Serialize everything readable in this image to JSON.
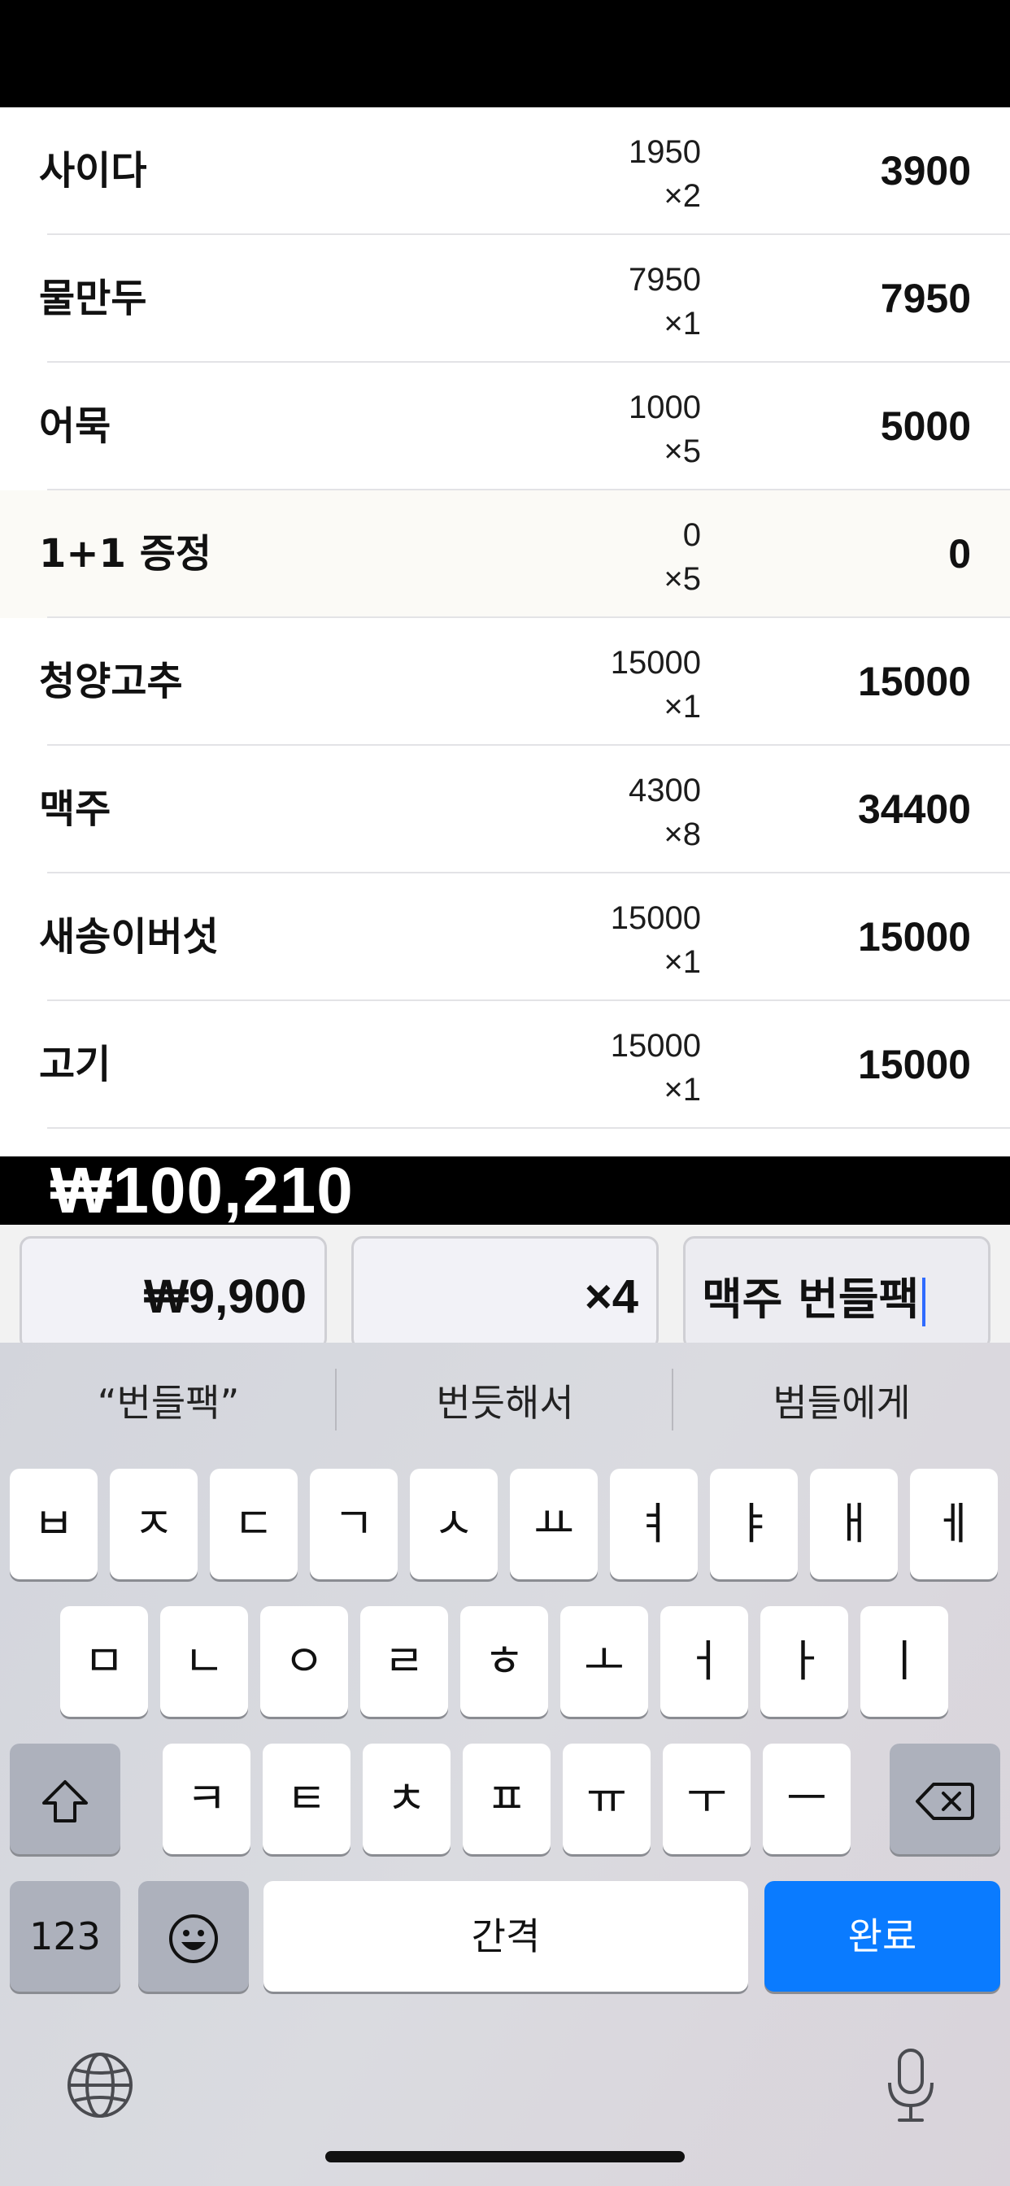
{
  "items": [
    {
      "name": "사이다",
      "unit_price": "1950",
      "qty": "×2",
      "total": "3900"
    },
    {
      "name": "물만두",
      "unit_price": "7950",
      "qty": "×1",
      "total": "7950"
    },
    {
      "name": "어묵",
      "unit_price": "1000",
      "qty": "×5",
      "total": "5000"
    },
    {
      "name": "1+1 증정",
      "unit_price": "0",
      "qty": "×5",
      "total": "0"
    },
    {
      "name": "청양고추",
      "unit_price": "15000",
      "qty": "×1",
      "total": "15000"
    },
    {
      "name": "맥주",
      "unit_price": "4300",
      "qty": "×8",
      "total": "34400"
    },
    {
      "name": "새송이버섯",
      "unit_price": "15000",
      "qty": "×1",
      "total": "15000"
    },
    {
      "name": "고기",
      "unit_price": "15000",
      "qty": "×1",
      "total": "15000"
    }
  ],
  "grand_total": "₩100,210",
  "input": {
    "price_value": "₩9,900",
    "qty_value": "×4",
    "name_value": "맥주 번들팩"
  },
  "keyboard": {
    "suggestions": [
      "“번들팩”",
      "번듯해서",
      "범들에게"
    ],
    "row1": [
      "ㅂ",
      "ㅈ",
      "ㄷ",
      "ㄱ",
      "ㅅ",
      "ㅛ",
      "ㅕ",
      "ㅑ",
      "ㅐ",
      "ㅔ"
    ],
    "row2": [
      "ㅁ",
      "ㄴ",
      "ㅇ",
      "ㄹ",
      "ㅎ",
      "ㅗ",
      "ㅓ",
      "ㅏ",
      "ㅣ"
    ],
    "row3": [
      "ㅋ",
      "ㅌ",
      "ㅊ",
      "ㅍ",
      "ㅠ",
      "ㅜ",
      "ㅡ"
    ],
    "numbers_label": "123",
    "space_label": "간격",
    "done_label": "완료"
  },
  "icons": {
    "shift": "shift-icon",
    "backspace": "backspace-icon",
    "emoji": "emoji-icon",
    "globe": "globe-icon",
    "mic": "microphone-icon"
  },
  "colors": {
    "done_key": "#0a7bff",
    "highlight_row": "#fbfaf6",
    "caret": "#2f6bff"
  }
}
